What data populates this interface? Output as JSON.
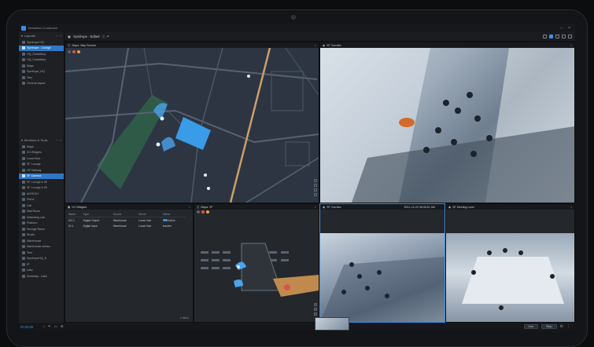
{
  "app": {
    "title": "Metadium Conductor"
  },
  "sidebar": {
    "layouts_header": "Layouts",
    "layouts": [
      {
        "label": "Syndrope HQ",
        "selected": false
      },
      {
        "label": "Syndrope - Lounge",
        "selected": true
      },
      {
        "label": "HQ_Subsidiary",
        "selected": false
      },
      {
        "label": "HQ_Subsidiary",
        "selected": false
      },
      {
        "label": "Maps",
        "selected": false
      },
      {
        "label": "Syndrope_HQ",
        "selected": false
      },
      {
        "label": "Test",
        "selected": false
      },
      {
        "label": "General layout",
        "selected": false
      }
    ],
    "tools_header": "Monitors & Tools",
    "tools": [
      {
        "label": "Maps",
        "selected": false
      },
      {
        "label": "I/O Widgets",
        "selected": false
      },
      {
        "label": "Local Host",
        "selected": false
      },
      {
        "label": "SF Lounge",
        "selected": false
      },
      {
        "label": "HP Hallway",
        "selected": false
      },
      {
        "label": "SF Camera",
        "selected": true
      },
      {
        "label": "SF Lounge # 4K",
        "selected": false
      },
      {
        "label": "SF Lounge # 4K",
        "selected": false
      },
      {
        "label": "ANTECH",
        "selected": false
      },
      {
        "label": "Petrol",
        "selected": false
      },
      {
        "label": "Lab",
        "selected": false
      },
      {
        "label": "Mail Room",
        "selected": false
      },
      {
        "label": "Marketing Lab",
        "selected": false
      },
      {
        "label": "Platform",
        "selected": false
      },
      {
        "label": "Storage Room",
        "selected": false
      },
      {
        "label": "Studio",
        "selected": false
      },
      {
        "label": "Warehouse",
        "selected": false
      },
      {
        "label": "Warehouse entran...",
        "selected": false
      },
      {
        "label": "Test",
        "selected": false
      },
      {
        "label": "SyndropeHQ_S",
        "selected": false
      },
      {
        "label": "IP",
        "selected": false
      },
      {
        "label": "Lake",
        "selected": false
      },
      {
        "label": "Subsiday - Lake",
        "selected": false
      }
    ]
  },
  "toolbar": {
    "layout_name": "Syndrope - Edited"
  },
  "tiles": {
    "map": {
      "title": "Maps: Map Service"
    },
    "corridor": {
      "title": "SF Corridor"
    },
    "io": {
      "title": "I/O Widgets",
      "columns": [
        "Name",
        "Type",
        "Source",
        "Server",
        "Status"
      ],
      "rows": [
        {
          "name": "DO 1",
          "type": "Digital Output",
          "source": "Warehouse",
          "server": "Local Host",
          "status": "Active"
        },
        {
          "name": "DI 1",
          "type": "Digital Input",
          "source": "Warehouse",
          "server": "Local Host",
          "status": "Inactive"
        }
      ],
      "footer": "2 Items"
    },
    "floorplan": {
      "title": "Maps: 3F"
    },
    "corridor2": {
      "title": "SF Corridor",
      "timestamp": "2021-12-23 08:06:51 AM"
    },
    "meeting": {
      "title": "SF Meeting room"
    }
  },
  "bottombar": {
    "timecode": "00:20:56",
    "live_label": "Live",
    "stop_label": "Stop"
  }
}
